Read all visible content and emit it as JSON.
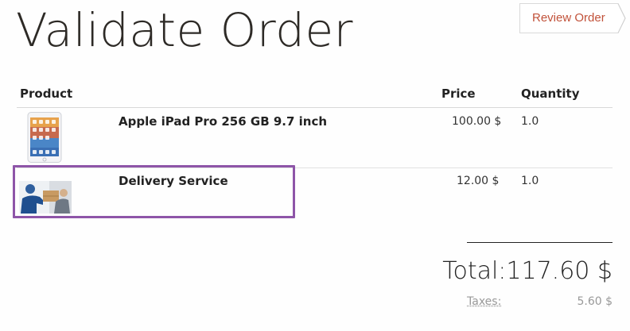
{
  "page_title": "Validate Order",
  "breadcrumb": {
    "label": "Review Order"
  },
  "table": {
    "columns": {
      "product": "Product",
      "price": "Price",
      "quantity": "Quantity"
    },
    "rows": [
      {
        "name": "Apple iPad Pro 256 GB 9.7 inch",
        "price": "100.00 $",
        "quantity": "1.0",
        "thumbnail_icon": "tablet-icon"
      },
      {
        "name": "Delivery Service",
        "price": "12.00 $",
        "quantity": "1.0",
        "thumbnail_icon": "delivery-person-icon"
      }
    ]
  },
  "summary": {
    "total_label": "Total:",
    "total_value": "117.60 $",
    "taxes_label": "Taxes:",
    "taxes_value": "5.60 $"
  },
  "colors": {
    "accent": "#c1523a",
    "highlight": "#8e55a8",
    "text": "#222222"
  }
}
